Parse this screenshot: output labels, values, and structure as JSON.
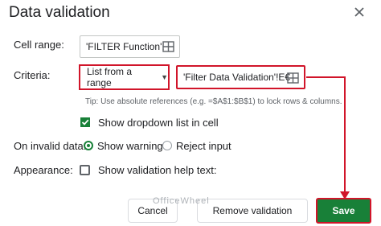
{
  "dialog": {
    "title": "Data validation",
    "close_icon": "close-icon"
  },
  "cell_range": {
    "label": "Cell range:",
    "value": "'FILTER Function'!",
    "icon": "grid-select-icon"
  },
  "criteria": {
    "label": "Criteria:",
    "type_value": "List from a range",
    "range_value": "'Filter Data Validation'!E€",
    "icon": "grid-select-icon"
  },
  "tip": {
    "text": "Tip: Use absolute references (e.g. =$A$1:$B$1) to lock rows & columns."
  },
  "dropdown_option": {
    "label": "Show dropdown list in cell",
    "checked": true
  },
  "invalid_data": {
    "label": "On invalid data:",
    "options": [
      "Show warning",
      "Reject input"
    ],
    "selected": "Show warning"
  },
  "appearance": {
    "label": "Appearance:",
    "help_text_label": "Show validation help text:",
    "checked": false
  },
  "buttons": {
    "cancel": "Cancel",
    "remove": "Remove validation",
    "save": "Save"
  },
  "watermark": "OfficeWheel",
  "colors": {
    "accent_green": "#188038",
    "highlight_red": "#d1152a"
  }
}
